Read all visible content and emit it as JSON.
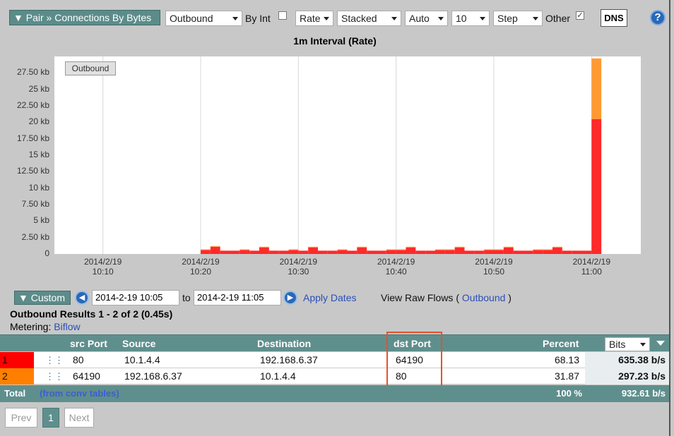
{
  "toolbar": {
    "report_label": "▼ Pair » Connections By Bytes",
    "direction": "Outbound",
    "by_int_label": "By Int",
    "by_int_checked": false,
    "metric": "Rate",
    "mode": "Stacked",
    "scale": "Auto",
    "top_n": "10",
    "style": "Step",
    "other_label": "Other",
    "other_checked": true,
    "dns_label": "DNS",
    "help_label": "?"
  },
  "chart_data": {
    "type": "bar",
    "title": "1m Interval (Rate)",
    "legend": [
      "Outbound"
    ],
    "y_ticks": [
      "27.50 kb",
      "25 kb",
      "22.50 kb",
      "20 kb",
      "17.50 kb",
      "15 kb",
      "12.50 kb",
      "10 kb",
      "7.50 kb",
      "5 kb",
      "2.50 kb",
      "0"
    ],
    "x_ticks": [
      {
        "date": "2014/2/19",
        "time": "10:10"
      },
      {
        "date": "2014/2/19",
        "time": "10:20"
      },
      {
        "date": "2014/2/19",
        "time": "10:30"
      },
      {
        "date": "2014/2/19",
        "time": "10:40"
      },
      {
        "date": "2014/2/19",
        "time": "10:50"
      },
      {
        "date": "2014/2/19",
        "time": "11:00"
      }
    ],
    "ylim": [
      0,
      30
    ],
    "grid": true,
    "series": [
      {
        "color": "#ff2a2a",
        "minutes": [
          20,
          21,
          22,
          23,
          24,
          25,
          26,
          27,
          28,
          29,
          30,
          31,
          32,
          33,
          34,
          35,
          36,
          37,
          38,
          39,
          40,
          41,
          42,
          43,
          44,
          45,
          46,
          47,
          48,
          49,
          50,
          51,
          52,
          53,
          54,
          55,
          56,
          57,
          58,
          59,
          60
        ],
        "values": [
          0.6,
          1.1,
          0.5,
          0.5,
          0.6,
          0.5,
          1.0,
          0.5,
          0.5,
          0.6,
          0.5,
          1.0,
          0.5,
          0.5,
          0.6,
          0.5,
          1.0,
          0.5,
          0.5,
          0.6,
          0.6,
          1.0,
          0.5,
          0.5,
          0.6,
          0.6,
          1.0,
          0.5,
          0.5,
          0.6,
          0.6,
          1.0,
          0.5,
          0.5,
          0.6,
          0.6,
          1.0,
          0.5,
          0.5,
          0.5,
          20.5
        ]
      },
      {
        "color": "#ff9a33",
        "minutes": [
          20,
          21,
          22,
          23,
          24,
          25,
          26,
          27,
          28,
          29,
          30,
          31,
          32,
          33,
          34,
          35,
          36,
          37,
          38,
          39,
          40,
          41,
          42,
          43,
          44,
          45,
          46,
          47,
          48,
          49,
          50,
          51,
          52,
          53,
          54,
          55,
          56,
          57,
          58,
          59,
          60
        ],
        "values": [
          0.1,
          0.1,
          0,
          0,
          0.1,
          0,
          0.1,
          0,
          0,
          0.1,
          0,
          0.1,
          0,
          0,
          0.1,
          0,
          0.1,
          0,
          0,
          0.1,
          0.1,
          0.1,
          0,
          0,
          0.1,
          0.1,
          0.1,
          0,
          0,
          0.1,
          0.1,
          0.1,
          0,
          0,
          0.1,
          0.1,
          0.1,
          0,
          0,
          0,
          9.2
        ]
      }
    ]
  },
  "dates": {
    "custom_label": "▼ Custom",
    "from": "2014-2-19 10:05",
    "to_label": "to",
    "to": "2014-2-19 11:05",
    "apply_label": "Apply Dates",
    "raw_flows_prefix": "View Raw Flows (",
    "raw_flows_link": "Outbound",
    "raw_flows_suffix": ")"
  },
  "results": {
    "summary": "Outbound Results 1 - 2 of 2 (0.45s)",
    "metering_label": "Metering:",
    "metering_value": "Biflow"
  },
  "table": {
    "headers": {
      "src_port": "src Port",
      "source": "Source",
      "destination": "Destination",
      "dst_port": "dst Port",
      "percent": "Percent",
      "unit": "Bits"
    },
    "rows": [
      {
        "rank": "1",
        "color": "#ff0000",
        "src_port": "80",
        "source": "10.1.4.4",
        "destination": "192.168.6.37",
        "dst_port": "64190",
        "percent": "68.13",
        "rate": "635.38 b/s"
      },
      {
        "rank": "2",
        "color": "#ff8000",
        "src_port": "64190",
        "source": "192.168.6.37",
        "destination": "10.1.4.4",
        "dst_port": "80",
        "percent": "31.87",
        "rate": "297.23 b/s"
      }
    ],
    "total_label": "Total",
    "total_note": "(from conv tables)",
    "total_percent": "100 %",
    "total_rate": "932.61 b/s"
  },
  "pager": {
    "prev": "Prev",
    "page": "1",
    "next": "Next"
  }
}
